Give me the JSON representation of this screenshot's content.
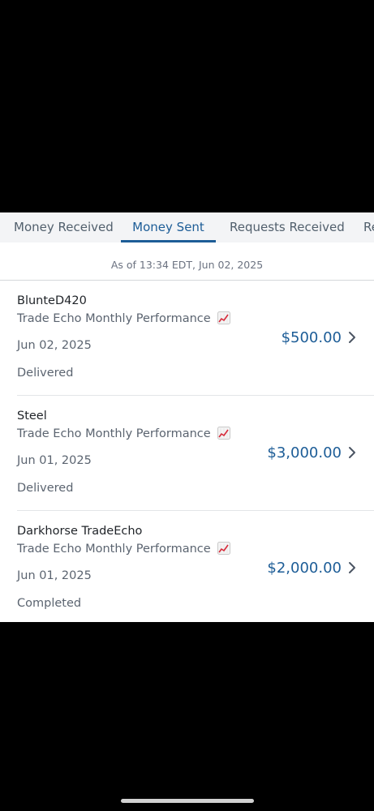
{
  "tabs": [
    {
      "label": "Money Received",
      "active": false
    },
    {
      "label": "Money Sent",
      "active": true
    },
    {
      "label": "Requests Received",
      "active": false
    },
    {
      "label": "Re",
      "active": false
    }
  ],
  "as_of": "As of 13:34 EDT, Jun 02, 2025",
  "transactions": [
    {
      "name": "BlunteD420",
      "memo": "Trade Echo Monthly Performance",
      "memo_icon": "chart-increasing-icon",
      "date": "Jun 02, 2025",
      "status": "Delivered",
      "amount": "$500.00"
    },
    {
      "name": "Steel",
      "memo": "Trade Echo Monthly Performance",
      "memo_icon": "chart-increasing-icon",
      "date": "Jun 01, 2025",
      "status": "Delivered",
      "amount": "$3,000.00"
    },
    {
      "name": "Darkhorse TradeEcho",
      "memo": "Trade Echo Monthly Performance",
      "memo_icon": "chart-increasing-icon",
      "date": "Jun 01, 2025",
      "status": "Completed",
      "amount": "$2,000.00"
    }
  ],
  "colors": {
    "accent": "#1d5d97",
    "tab_bar_bg": "#f3f4f6",
    "secondary_text": "#5b6470",
    "background": "#000000"
  }
}
